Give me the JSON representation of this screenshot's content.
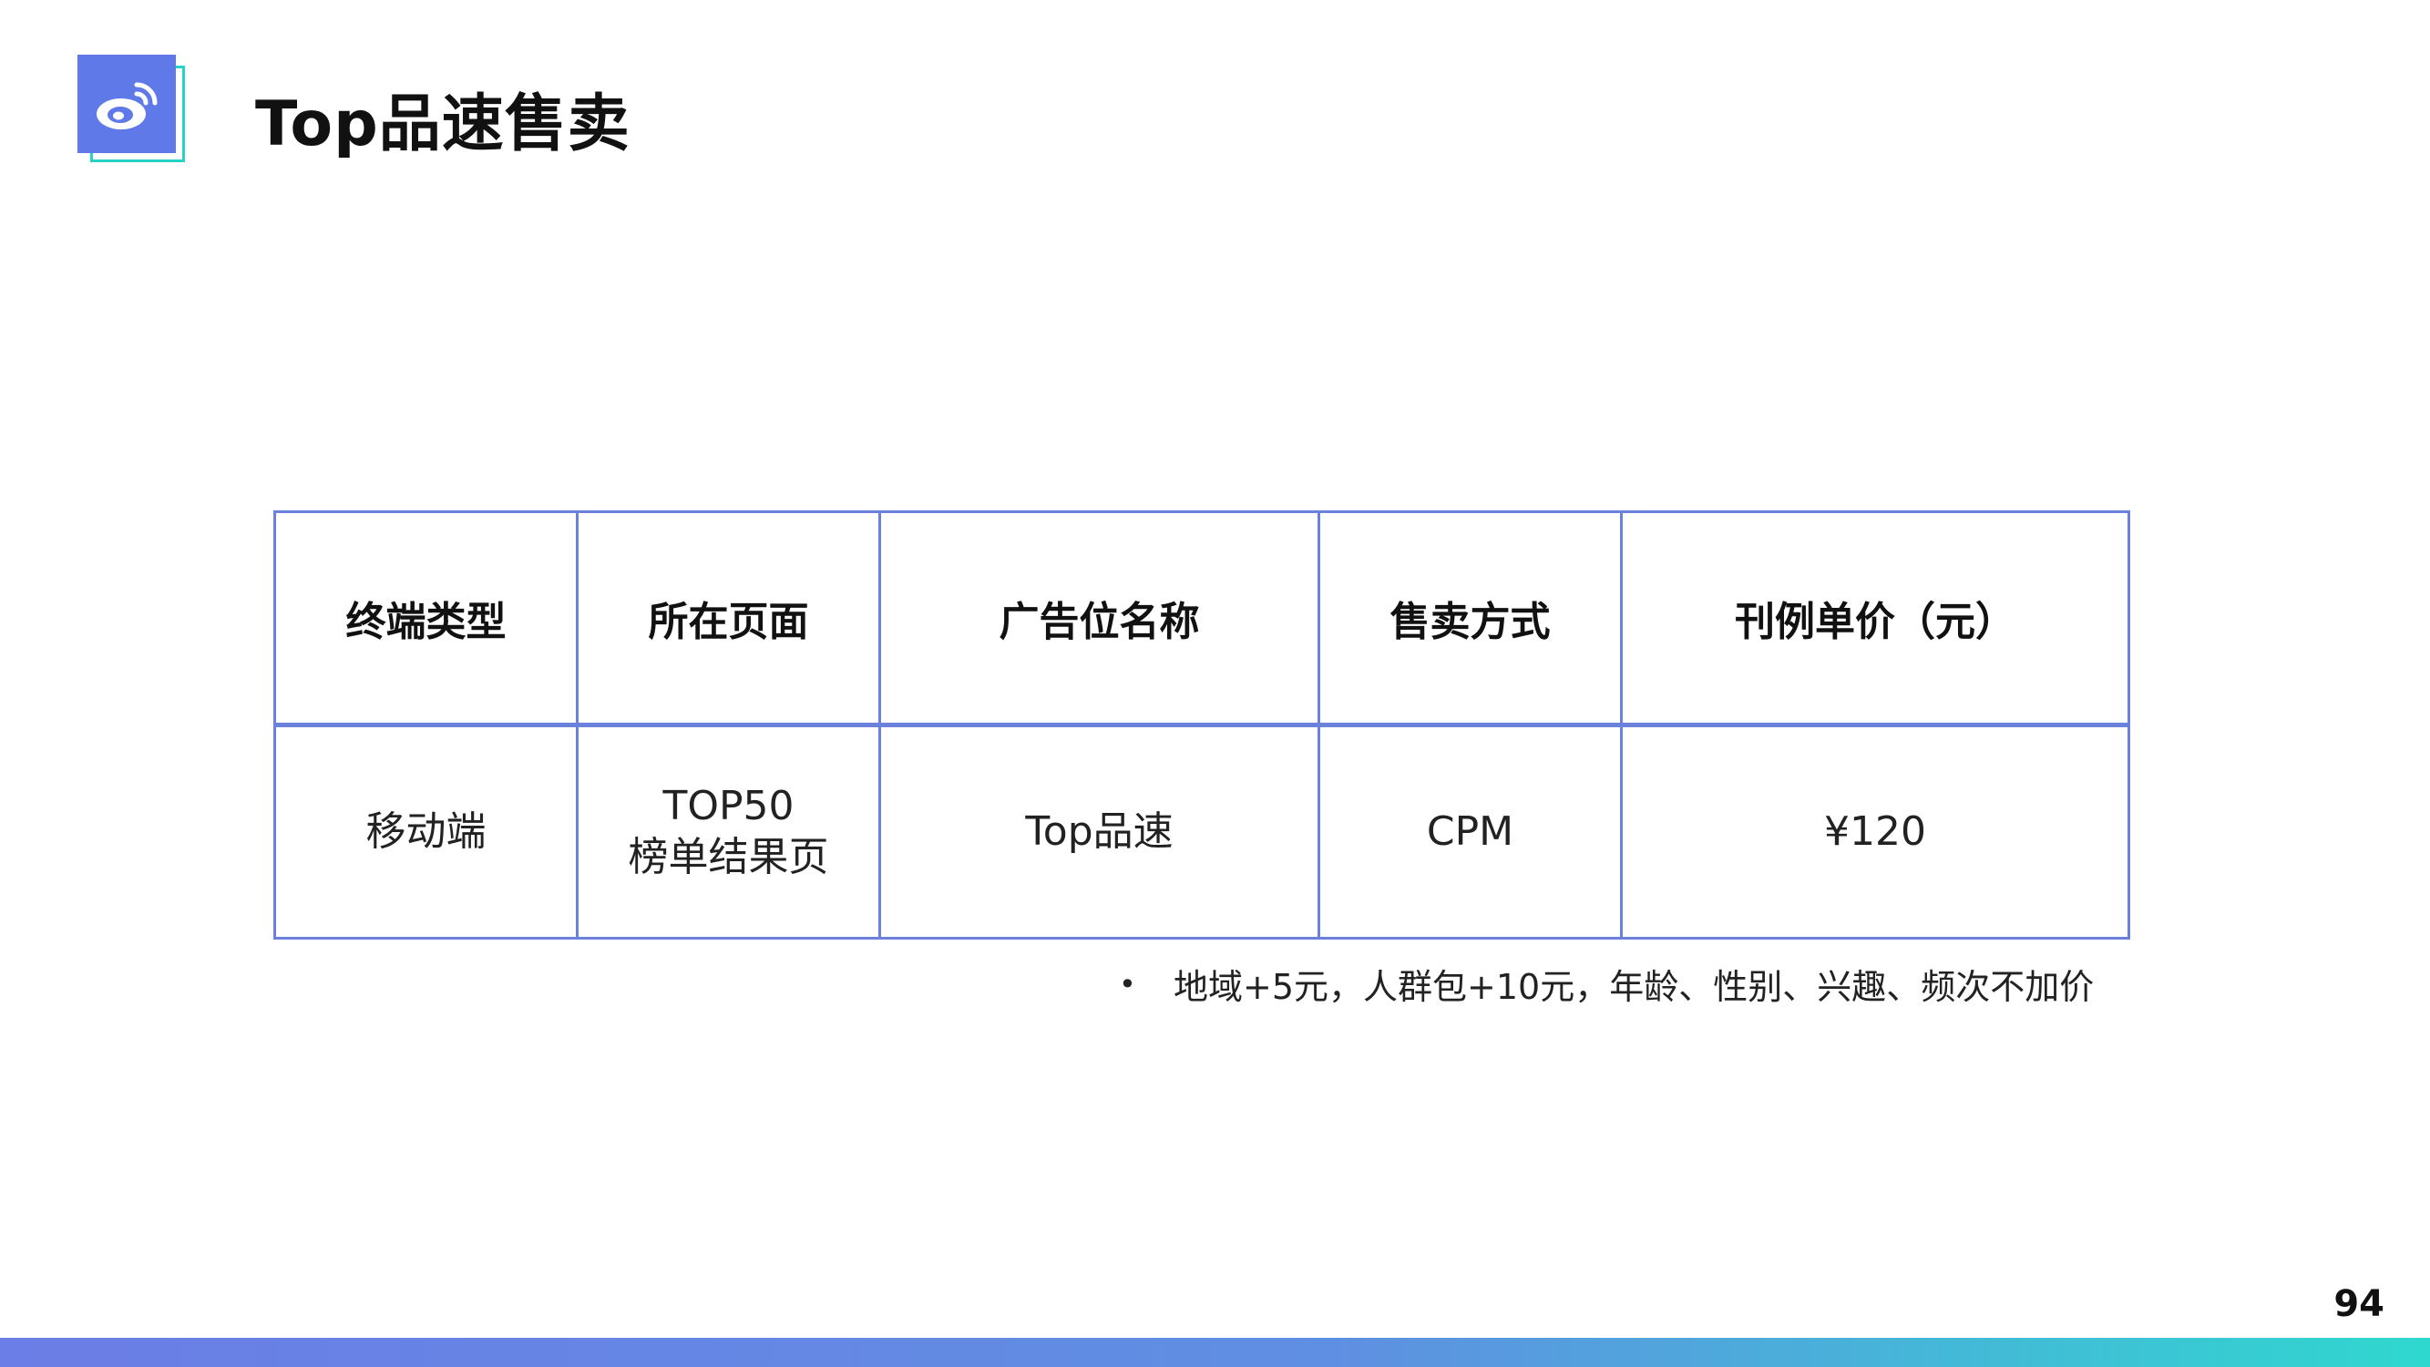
{
  "header": {
    "logo_icon": "weibo-icon",
    "title": "Top品速售卖"
  },
  "table": {
    "headers": [
      "终端类型",
      "所在页面",
      "广告位名称",
      "售卖方式",
      "刊例单价（元）"
    ],
    "rows": [
      {
        "terminal": "移动端",
        "page_line1": "TOP50",
        "page_line2": "榜单结果页",
        "ad_name": "Top品速",
        "sale_method": "CPM",
        "price": "¥120"
      }
    ]
  },
  "footnote": {
    "bullet": "•",
    "text": "地域+5元，人群包+10元，年龄、性别、兴趣、频次不加价"
  },
  "page_number": "94",
  "colors": {
    "accent": "#6079e8",
    "accent_secondary": "#27d3c6",
    "table_border": "#6a82dc"
  }
}
